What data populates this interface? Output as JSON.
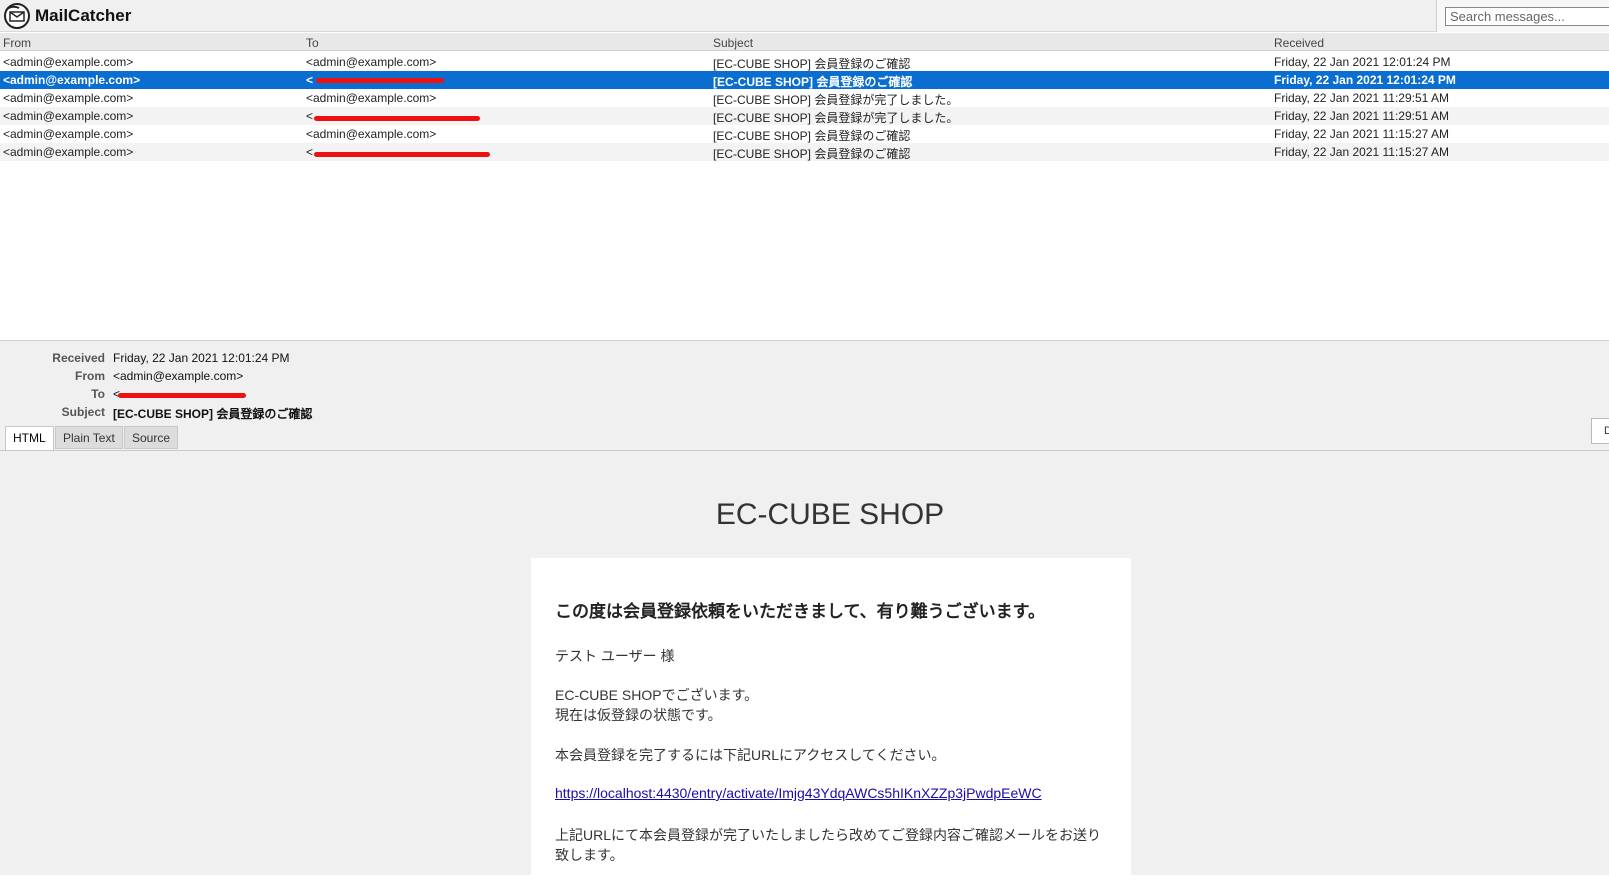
{
  "app": {
    "title": "MailCatcher",
    "search_placeholder": "Search messages..."
  },
  "list": {
    "columns": [
      "From",
      "To",
      "Subject",
      "Received"
    ],
    "rows": [
      {
        "from": "<admin@example.com>",
        "to": "<admin@example.com>",
        "subject": "[EC-CUBE SHOP] 会員登録のご確認",
        "received": "Friday, 22 Jan 2021 12:01:24 PM"
      },
      {
        "from": "<admin@example.com>",
        "to": "<",
        "subject": "[EC-CUBE SHOP] 会員登録のご確認",
        "received": "Friday, 22 Jan 2021 12:01:24 PM"
      },
      {
        "from": "<admin@example.com>",
        "to": "<admin@example.com>",
        "subject": "[EC-CUBE SHOP] 会員登録が完了しました。",
        "received": "Friday, 22 Jan 2021 11:29:51 AM"
      },
      {
        "from": "<admin@example.com>",
        "to": "<",
        "subject": "[EC-CUBE SHOP] 会員登録が完了しました。",
        "received": "Friday, 22 Jan 2021 11:29:51 AM"
      },
      {
        "from": "<admin@example.com>",
        "to": "<admin@example.com>",
        "subject": "[EC-CUBE SHOP] 会員登録のご確認",
        "received": "Friday, 22 Jan 2021 11:15:27 AM"
      },
      {
        "from": "<admin@example.com>",
        "to": "<",
        "subject": "[EC-CUBE SHOP] 会員登録のご確認",
        "received": "Friday, 22 Jan 2021 11:15:27 AM"
      }
    ]
  },
  "meta": {
    "labels": {
      "received": "Received",
      "from": "From",
      "to": "To",
      "subject": "Subject"
    },
    "received": "Friday, 22 Jan 2021 12:01:24 PM",
    "from": "<admin@example.com>",
    "to": "<",
    "subject": "[EC-CUBE SHOP] 会員登録のご確認"
  },
  "tabs": [
    "HTML",
    "Plain Text",
    "Source"
  ],
  "side_button": "D",
  "email": {
    "shop_name": "EC-CUBE SHOP",
    "headline": "この度は会員登録依頼をいただきまして、有り難うございます。",
    "greeting": "テスト ユーザー 様",
    "intro_1": "EC-CUBE SHOPでございます。",
    "intro_2": "現在は仮登録の状態です。",
    "instruction": "本会員登録を完了するには下記URLにアクセスしてください。",
    "link": "https://localhost:4430/entry/activate/Imjg43YdqAWCs5hIKnXZZp3jPwdpEeWC",
    "closing_1": "上記URLにて本会員登録が完了いたしましたら改めてご登録内容ご確認メールをお送り",
    "closing_2": "致します。"
  },
  "colors": {
    "selection": "#0a6ed1",
    "redaction": "#ee1111",
    "link": "#1a0dab"
  }
}
